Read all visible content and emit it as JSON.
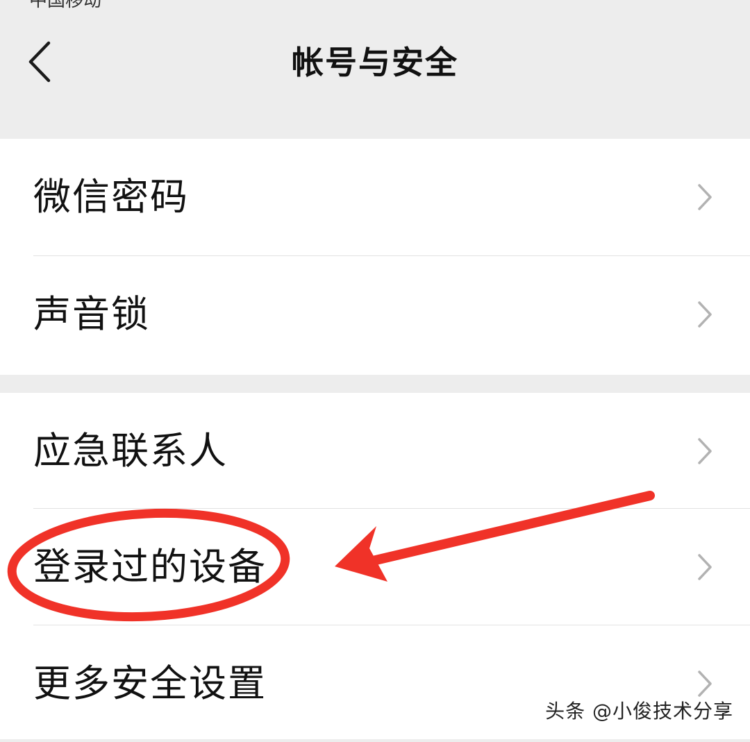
{
  "status_bar": {
    "carrier": "中国移动"
  },
  "nav": {
    "title": "帐号与安全",
    "back_icon": "chevron-left-icon"
  },
  "groups": [
    {
      "items": [
        {
          "label": "微信密码",
          "icon": "chevron-right-icon"
        },
        {
          "label": "声音锁",
          "icon": "chevron-right-icon"
        }
      ]
    },
    {
      "items": [
        {
          "label": "应急联系人",
          "icon": "chevron-right-icon"
        },
        {
          "label": "登录过的设备",
          "icon": "chevron-right-icon"
        },
        {
          "label": "更多安全设置",
          "icon": "chevron-right-icon"
        }
      ]
    }
  ],
  "annotation": {
    "type": "red-ellipse-and-arrow",
    "target": "登录过的设备",
    "color": "#f03228"
  },
  "watermark": "头条 @小俊技术分享",
  "colors": {
    "background": "#ededed",
    "cell": "#ffffff",
    "text": "#111111",
    "chevron": "#b2b2b2",
    "annotation": "#f03228"
  }
}
